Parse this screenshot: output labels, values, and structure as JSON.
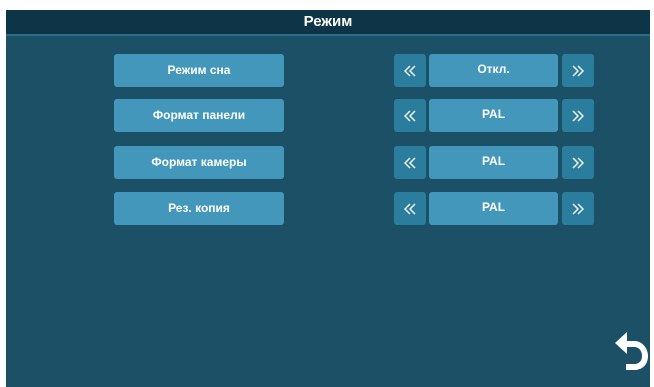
{
  "header": {
    "title": "Режим"
  },
  "settings": [
    {
      "label": "Режим сна",
      "value": "Откл."
    },
    {
      "label": "Формат панели",
      "value": "PAL"
    },
    {
      "label": "Формат камеры",
      "value": "PAL"
    },
    {
      "label": "Рез. копия",
      "value": "PAL"
    }
  ],
  "icons": {
    "prev": "chevron-double-left-icon",
    "next": "chevron-double-right-icon",
    "back": "undo-arrow-icon"
  },
  "colors": {
    "background": "#1b5066",
    "title_bar": "#0e3547",
    "label_button": "#4397bb",
    "arrow_button": "#2a7d9c",
    "text": "#ffffff"
  }
}
